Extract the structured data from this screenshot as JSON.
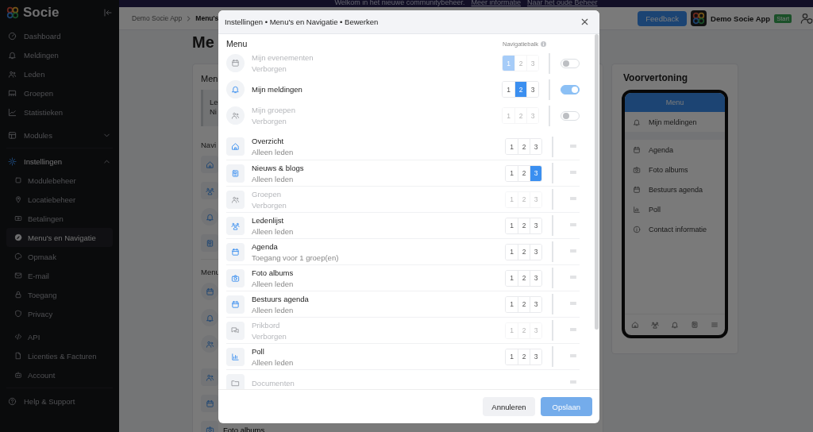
{
  "banner": {
    "text": "Welkom in het nieuwe communitybeheer.",
    "links": [
      "Meer informatie",
      "Naar het oude Beheer"
    ]
  },
  "sidebar": {
    "brand": "Socie",
    "items": [
      {
        "kind": "link",
        "label": "Dashboard",
        "selected": false
      },
      {
        "kind": "link",
        "label": "Meldingen",
        "selected": false
      },
      {
        "kind": "link",
        "label": "Leden",
        "selected": false
      },
      {
        "kind": "link",
        "label": "Groepen",
        "selected": false
      },
      {
        "kind": "link",
        "label": "Statistieken",
        "selected": false
      },
      {
        "kind": "group",
        "label": "Modules",
        "expanded": false
      },
      {
        "kind": "group",
        "label": "Instellingen",
        "expanded": true,
        "children": [
          {
            "label": "Modulebeheer",
            "selected": false
          },
          {
            "label": "Locatiebeheer",
            "selected": false
          },
          {
            "label": "Betalingen",
            "selected": false
          },
          {
            "label": "Menu's en Navigatie",
            "selected": true
          },
          {
            "label": "Opmaak",
            "selected": false
          },
          {
            "label": "E-mail",
            "selected": false
          },
          {
            "label": "Toegang",
            "selected": false
          },
          {
            "label": "Privacy",
            "selected": false
          },
          {
            "label": "API",
            "selected": false
          },
          {
            "label": "Licenties & Facturen",
            "selected": false
          },
          {
            "label": "Account",
            "selected": false
          }
        ]
      },
      {
        "kind": "link",
        "label": "Help & Support",
        "selected": false
      }
    ]
  },
  "topbar": {
    "breadcrumb": [
      "Demo Socie App",
      "Menu's"
    ],
    "feedback": "Feedback",
    "app_name": "Demo Socie App",
    "plan_badge": "Start"
  },
  "page": {
    "title": "Me",
    "card_title": "Men",
    "notice": [
      "Le",
      "Ni"
    ],
    "nav_heading": "Navi",
    "menu_heading": "Menu",
    "last_item": "Foto albums"
  },
  "preview": {
    "title": "Voorvertoning",
    "header": "Menu",
    "pinned": [
      "Mijn meldingen"
    ],
    "items": [
      "Agenda",
      "Foto albums",
      "Bestuurs agenda",
      "Poll",
      "Contact informatie"
    ]
  },
  "modal": {
    "title": "Instellingen • Menu's en Navigatie • Bewerken",
    "heading": "Menu",
    "nav_label": "Navigatiebalk",
    "rows": [
      {
        "kind": "toggle",
        "title": "Mijn evenementen",
        "subtitle": "Verborgen",
        "hidden": true,
        "on": false,
        "slots": [
          {
            "label": "1",
            "selected": true
          },
          {
            "label": "2",
            "selected": false
          },
          {
            "label": "3",
            "selected": false
          }
        ]
      },
      {
        "kind": "toggle",
        "title": "Mijn meldingen",
        "hidden": false,
        "on": true,
        "slots": [
          {
            "label": "1",
            "selected": false
          },
          {
            "label": "2",
            "selected": true
          },
          {
            "label": "3",
            "selected": false
          }
        ]
      },
      {
        "kind": "toggle",
        "title": "Mijn groepen",
        "subtitle": "Verborgen",
        "hidden": true,
        "on": false,
        "slots": [
          {
            "label": "1",
            "selected": false
          },
          {
            "label": "2",
            "selected": false
          },
          {
            "label": "3",
            "selected": false
          }
        ]
      },
      {
        "kind": "drag",
        "title": "Overzicht",
        "subtitle": "Alleen leden",
        "hidden": false,
        "slots": [
          {
            "label": "1",
            "selected": false
          },
          {
            "label": "2",
            "selected": false
          },
          {
            "label": "3",
            "selected": false
          }
        ]
      },
      {
        "kind": "drag",
        "title": "Nieuws & blogs",
        "subtitle": "Alleen leden",
        "hidden": false,
        "slots": [
          {
            "label": "1",
            "selected": false
          },
          {
            "label": "2",
            "selected": false
          },
          {
            "label": "3",
            "selected": true
          }
        ]
      },
      {
        "kind": "drag",
        "title": "Groepen",
        "subtitle": "Verborgen",
        "hidden": true,
        "slots": [
          {
            "label": "1",
            "selected": false
          },
          {
            "label": "2",
            "selected": false
          },
          {
            "label": "3",
            "selected": false
          }
        ]
      },
      {
        "kind": "drag",
        "title": "Ledenlijst",
        "subtitle": "Alleen leden",
        "hidden": false,
        "slots": [
          {
            "label": "1",
            "selected": false
          },
          {
            "label": "2",
            "selected": false
          },
          {
            "label": "3",
            "selected": false
          }
        ]
      },
      {
        "kind": "drag",
        "title": "Agenda",
        "subtitle": "Toegang voor 1 groep(en)",
        "hidden": false,
        "slots": [
          {
            "label": "1",
            "selected": false
          },
          {
            "label": "2",
            "selected": false
          },
          {
            "label": "3",
            "selected": false
          }
        ]
      },
      {
        "kind": "drag",
        "title": "Foto albums",
        "subtitle": "Alleen leden",
        "hidden": false,
        "slots": [
          {
            "label": "1",
            "selected": false
          },
          {
            "label": "2",
            "selected": false
          },
          {
            "label": "3",
            "selected": false
          }
        ]
      },
      {
        "kind": "drag",
        "title": "Bestuurs agenda",
        "subtitle": "Alleen leden",
        "hidden": false,
        "slots": [
          {
            "label": "1",
            "selected": false
          },
          {
            "label": "2",
            "selected": false
          },
          {
            "label": "3",
            "selected": false
          }
        ]
      },
      {
        "kind": "drag",
        "title": "Prikbord",
        "subtitle": "Verborgen",
        "hidden": true,
        "slots": [
          {
            "label": "1",
            "selected": false
          },
          {
            "label": "2",
            "selected": false
          },
          {
            "label": "3",
            "selected": false
          }
        ]
      },
      {
        "kind": "drag",
        "title": "Poll",
        "subtitle": "Alleen leden",
        "hidden": false,
        "slots": [
          {
            "label": "1",
            "selected": false
          },
          {
            "label": "2",
            "selected": false
          },
          {
            "label": "3",
            "selected": false
          }
        ]
      },
      {
        "kind": "drag",
        "title": "Documenten",
        "hidden": true
      }
    ],
    "buttons": [
      {
        "kind": "secondary",
        "label": "Annuleren",
        "disabled": false
      },
      {
        "kind": "primary",
        "label": "Opslaan",
        "disabled": true
      }
    ]
  }
}
